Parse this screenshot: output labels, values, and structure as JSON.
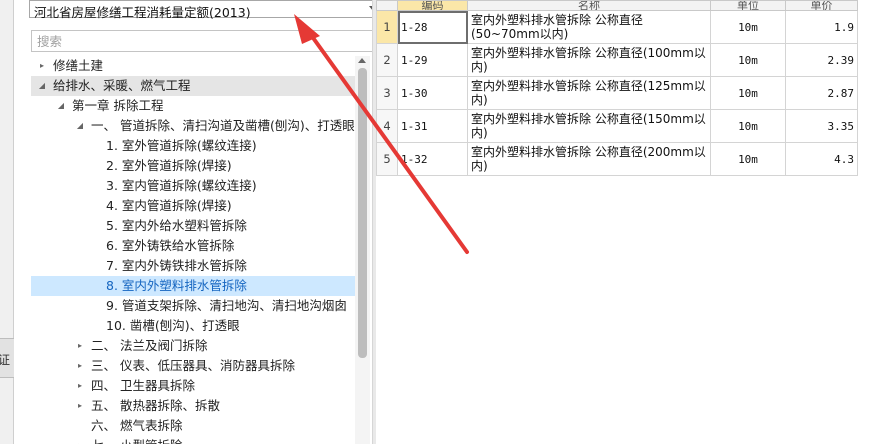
{
  "left_strip": {
    "label": "证"
  },
  "quota_select": {
    "value": "河北省房屋修缮工程消耗量定额(2013)"
  },
  "search": {
    "placeholder": "搜索"
  },
  "tree": [
    {
      "label": "修缮土建",
      "toggle": "▸",
      "level": 0
    },
    {
      "label": "给排水、采暖、燃气工程",
      "toggle": "◢",
      "level": 0,
      "state": "hl"
    },
    {
      "label": "第一章 拆除工程",
      "toggle": "◢",
      "level": 1
    },
    {
      "label": "一、 管道拆除、清扫沟道及凿槽(刨沟)、打透眼",
      "toggle": "◢",
      "level": 2
    },
    {
      "label": "1. 室外管道拆除(螺纹连接)",
      "toggle": "",
      "level": 3
    },
    {
      "label": "2. 室外管道拆除(焊接)",
      "toggle": "",
      "level": 3
    },
    {
      "label": "3. 室内管道拆除(螺纹连接)",
      "toggle": "",
      "level": 3
    },
    {
      "label": "4. 室内管道拆除(焊接)",
      "toggle": "",
      "level": 3
    },
    {
      "label": "5. 室内外给水塑料管拆除",
      "toggle": "",
      "level": 3
    },
    {
      "label": "6. 室外铸铁给水管拆除",
      "toggle": "",
      "level": 3
    },
    {
      "label": "7. 室内外铸铁排水管拆除",
      "toggle": "",
      "level": 3
    },
    {
      "label": "8. 室内外塑料排水管拆除",
      "toggle": "",
      "level": 3,
      "state": "selected"
    },
    {
      "label": "9. 管道支架拆除、清扫地沟、清扫地沟烟囱",
      "toggle": "",
      "level": 3
    },
    {
      "label": "10. 凿槽(刨沟)、打透眼",
      "toggle": "",
      "level": 3
    },
    {
      "label": "二、 法兰及阀门拆除",
      "toggle": "▸",
      "level": 2
    },
    {
      "label": "三、 仪表、低压器具、消防器具拆除",
      "toggle": "▸",
      "level": 2
    },
    {
      "label": "四、 卫生器具拆除",
      "toggle": "▸",
      "level": 2
    },
    {
      "label": "五、 散热器拆除、拆散",
      "toggle": "▸",
      "level": 2
    },
    {
      "label": "六、 燃气表拆除",
      "toggle": "",
      "level": 2
    },
    {
      "label": "七、 小型管拆除",
      "toggle": "▸",
      "level": 2
    }
  ],
  "grid": {
    "headers": [
      "",
      "编码",
      "名称",
      "单位",
      "单价"
    ],
    "rows": [
      {
        "idx": "1",
        "code": "1-28",
        "name": "室内外塑料排水管拆除 公称直径(50~70mm以内)",
        "unit": "10m",
        "price": "1.9"
      },
      {
        "idx": "2",
        "code": "1-29",
        "name": "室内外塑料排水管拆除 公称直径(100mm以内)",
        "unit": "10m",
        "price": "2.39"
      },
      {
        "idx": "3",
        "code": "1-30",
        "name": "室内外塑料排水管拆除 公称直径(125mm以内)",
        "unit": "10m",
        "price": "2.87"
      },
      {
        "idx": "4",
        "code": "1-31",
        "name": "室内外塑料排水管拆除 公称直径(150mm以内)",
        "unit": "10m",
        "price": "3.35"
      },
      {
        "idx": "5",
        "code": "1-32",
        "name": "室内外塑料排水管拆除 公称直径(200mm以内)",
        "unit": "10m",
        "price": "4.3"
      }
    ]
  },
  "colors": {
    "selected_bg": "#cde8ff",
    "selected_text": "#1565c0",
    "header_code_bg": "#fbe7a8",
    "annotation": "#e53935"
  }
}
